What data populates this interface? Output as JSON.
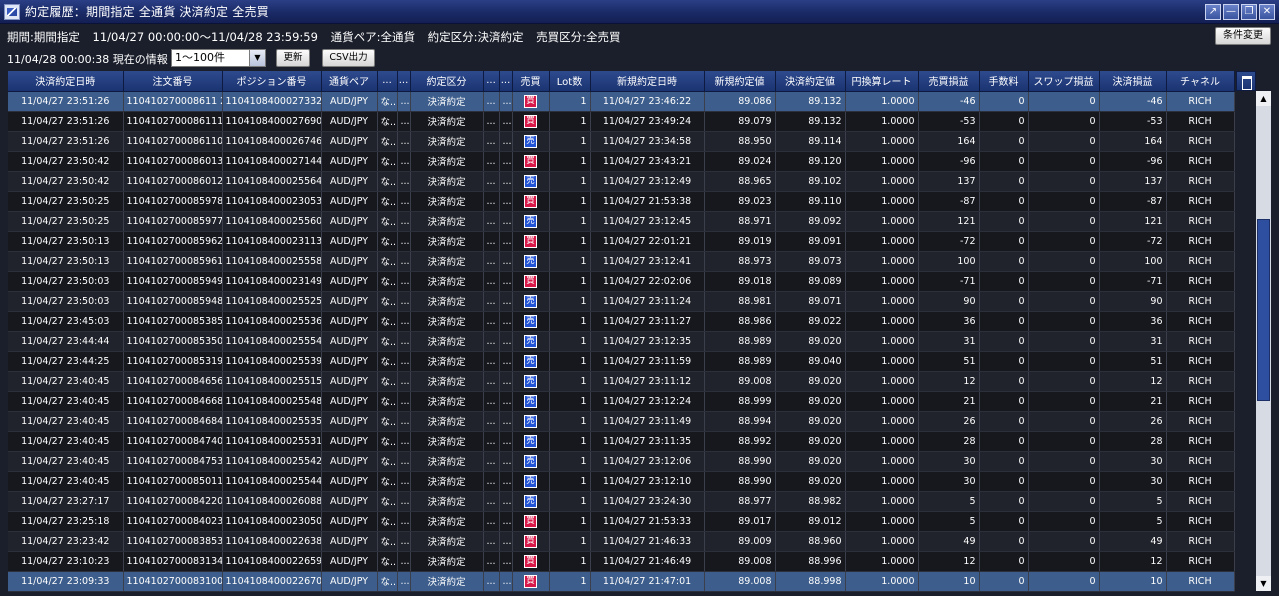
{
  "window": {
    "title": "約定履歴：期間指定 全通貨 決済約定 全売買",
    "controls": [
      "↗",
      "—",
      "❐",
      "✕"
    ]
  },
  "filters": {
    "period_label": "期間:期間指定",
    "period_range": "11/04/27 00:00:00〜11/04/28 23:59:59",
    "pair": "通貨ペア:全通貨",
    "trade_type": "約定区分:決済約定",
    "side": "売買区分:全売買",
    "change_button": "条件変更"
  },
  "toolbar": {
    "info": "11/04/28 00:00:38 現在の情報",
    "page_select": "1〜100件",
    "update_button": "更新",
    "csv_button": "CSV出力"
  },
  "grid": {
    "columns": [
      "決済約定日時",
      "注文番号",
      "ポジション番号",
      "通貨ペア",
      "...",
      "...",
      "約定区分",
      "...",
      "...",
      "売買",
      "Lot数",
      "新規約定日時",
      "新規約定値",
      "決済約定値",
      "円換算レート",
      "売買損益",
      "手数料",
      "スワップ損益",
      "決済損益",
      "チャネル"
    ],
    "rows": [
      [
        "11/04/27 23:51:26",
        "110410270008611 2",
        "1104108400027332",
        "AUD/JPY",
        "な...",
        "...",
        "決済約定",
        "...",
        "...",
        "買",
        "1",
        "11/04/27 23:46:22",
        "89.086",
        "89.132",
        "1.0000",
        "-46",
        "0",
        "0",
        "-46",
        "RICH"
      ],
      [
        "11/04/27 23:51:26",
        "1104102700086111",
        "1104108400027690",
        "AUD/JPY",
        "な...",
        "...",
        "決済約定",
        "...",
        "...",
        "買",
        "1",
        "11/04/27 23:49:24",
        "89.079",
        "89.132",
        "1.0000",
        "-53",
        "0",
        "0",
        "-53",
        "RICH"
      ],
      [
        "11/04/27 23:51:26",
        "1104102700086110",
        "1104108400026746",
        "AUD/JPY",
        "な...",
        "...",
        "決済約定",
        "...",
        "...",
        "売",
        "1",
        "11/04/27 23:34:58",
        "88.950",
        "89.114",
        "1.0000",
        "164",
        "0",
        "0",
        "164",
        "RICH"
      ],
      [
        "11/04/27 23:50:42",
        "1104102700086013",
        "1104108400027144",
        "AUD/JPY",
        "な...",
        "...",
        "決済約定",
        "...",
        "...",
        "買",
        "1",
        "11/04/27 23:43:21",
        "89.024",
        "89.120",
        "1.0000",
        "-96",
        "0",
        "0",
        "-96",
        "RICH"
      ],
      [
        "11/04/27 23:50:42",
        "1104102700086012",
        "1104108400025564",
        "AUD/JPY",
        "な...",
        "...",
        "決済約定",
        "...",
        "...",
        "売",
        "1",
        "11/04/27 23:12:49",
        "88.965",
        "89.102",
        "1.0000",
        "137",
        "0",
        "0",
        "137",
        "RICH"
      ],
      [
        "11/04/27 23:50:25",
        "1104102700085978",
        "1104108400023053",
        "AUD/JPY",
        "な...",
        "...",
        "決済約定",
        "...",
        "...",
        "買",
        "1",
        "11/04/27 21:53:38",
        "89.023",
        "89.110",
        "1.0000",
        "-87",
        "0",
        "0",
        "-87",
        "RICH"
      ],
      [
        "11/04/27 23:50:25",
        "1104102700085977",
        "1104108400025560",
        "AUD/JPY",
        "な...",
        "...",
        "決済約定",
        "...",
        "...",
        "売",
        "1",
        "11/04/27 23:12:45",
        "88.971",
        "89.092",
        "1.0000",
        "121",
        "0",
        "0",
        "121",
        "RICH"
      ],
      [
        "11/04/27 23:50:13",
        "1104102700085962",
        "1104108400023113",
        "AUD/JPY",
        "な...",
        "...",
        "決済約定",
        "...",
        "...",
        "買",
        "1",
        "11/04/27 22:01:21",
        "89.019",
        "89.091",
        "1.0000",
        "-72",
        "0",
        "0",
        "-72",
        "RICH"
      ],
      [
        "11/04/27 23:50:13",
        "1104102700085961",
        "1104108400025558",
        "AUD/JPY",
        "な...",
        "...",
        "決済約定",
        "...",
        "...",
        "売",
        "1",
        "11/04/27 23:12:41",
        "88.973",
        "89.073",
        "1.0000",
        "100",
        "0",
        "0",
        "100",
        "RICH"
      ],
      [
        "11/04/27 23:50:03",
        "1104102700085949",
        "1104108400023149",
        "AUD/JPY",
        "な...",
        "...",
        "決済約定",
        "...",
        "...",
        "買",
        "1",
        "11/04/27 22:02:06",
        "89.018",
        "89.089",
        "1.0000",
        "-71",
        "0",
        "0",
        "-71",
        "RICH"
      ],
      [
        "11/04/27 23:50:03",
        "1104102700085948",
        "1104108400025525",
        "AUD/JPY",
        "な...",
        "...",
        "決済約定",
        "...",
        "...",
        "売",
        "1",
        "11/04/27 23:11:24",
        "88.981",
        "89.071",
        "1.0000",
        "90",
        "0",
        "0",
        "90",
        "RICH"
      ],
      [
        "11/04/27 23:45:03",
        "1104102700085385",
        "1104108400025536",
        "AUD/JPY",
        "な...",
        "...",
        "決済約定",
        "...",
        "...",
        "売",
        "1",
        "11/04/27 23:11:27",
        "88.986",
        "89.022",
        "1.0000",
        "36",
        "0",
        "0",
        "36",
        "RICH"
      ],
      [
        "11/04/27 23:44:44",
        "1104102700085350",
        "1104108400025554",
        "AUD/JPY",
        "な...",
        "...",
        "決済約定",
        "...",
        "...",
        "売",
        "1",
        "11/04/27 23:12:35",
        "88.989",
        "89.020",
        "1.0000",
        "31",
        "0",
        "0",
        "31",
        "RICH"
      ],
      [
        "11/04/27 23:44:25",
        "1104102700085319",
        "1104108400025539",
        "AUD/JPY",
        "な...",
        "...",
        "決済約定",
        "...",
        "...",
        "売",
        "1",
        "11/04/27 23:11:59",
        "88.989",
        "89.040",
        "1.0000",
        "51",
        "0",
        "0",
        "51",
        "RICH"
      ],
      [
        "11/04/27 23:40:45",
        "1104102700084656",
        "1104108400025515",
        "AUD/JPY",
        "な...",
        "...",
        "決済約定",
        "... 8...",
        "...",
        "売",
        "1",
        "11/04/27 23:11:12",
        "89.008",
        "89.020",
        "1.0000",
        "12",
        "0",
        "0",
        "12",
        "RICH"
      ],
      [
        "11/04/27 23:40:45",
        "1104102700084668",
        "1104108400025548",
        "AUD/JPY",
        "な...",
        "...",
        "決済約定",
        "... 8...",
        "...",
        "売",
        "1",
        "11/04/27 23:12:24",
        "88.999",
        "89.020",
        "1.0000",
        "21",
        "0",
        "0",
        "21",
        "RICH"
      ],
      [
        "11/04/27 23:40:45",
        "1104102700084684",
        "1104108400025535",
        "AUD/JPY",
        "な...",
        "...",
        "決済約定",
        "... 8...",
        "...",
        "売",
        "1",
        "11/04/27 23:11:49",
        "88.994",
        "89.020",
        "1.0000",
        "26",
        "0",
        "0",
        "26",
        "RICH"
      ],
      [
        "11/04/27 23:40:45",
        "1104102700084740",
        "1104108400025531",
        "AUD/JPY",
        "な...",
        "...",
        "決済約定",
        "... 8...",
        "...",
        "売",
        "1",
        "11/04/27 23:11:35",
        "88.992",
        "89.020",
        "1.0000",
        "28",
        "0",
        "0",
        "28",
        "RICH"
      ],
      [
        "11/04/27 23:40:45",
        "1104102700084753",
        "1104108400025542",
        "AUD/JPY",
        "な...",
        "...",
        "決済約定",
        "... 8...",
        "...",
        "売",
        "1",
        "11/04/27 23:12:06",
        "88.990",
        "89.020",
        "1.0000",
        "30",
        "0",
        "0",
        "30",
        "RICH"
      ],
      [
        "11/04/27 23:40:45",
        "1104102700085011",
        "1104108400025544",
        "AUD/JPY",
        "な...",
        "...",
        "決済約定",
        "... 8...",
        "...",
        "売",
        "1",
        "11/04/27 23:12:10",
        "88.990",
        "89.020",
        "1.0000",
        "30",
        "0",
        "0",
        "30",
        "RICH"
      ],
      [
        "11/04/27 23:27:17",
        "1104102700084220",
        "1104108400026088",
        "AUD/JPY",
        "な...",
        "...",
        "決済約定",
        "... 8...",
        "...",
        "売",
        "1",
        "11/04/27 23:24:30",
        "88.977",
        "88.982",
        "1.0000",
        "5",
        "0",
        "0",
        "5",
        "RICH"
      ],
      [
        "11/04/27 23:25:18",
        "1104102700084023",
        "1104108400023050",
        "AUD/JPY",
        "な...",
        "...",
        "決済約定",
        "... 8...",
        "...",
        "買",
        "1",
        "11/04/27 21:53:33",
        "89.017",
        "89.012",
        "1.0000",
        "5",
        "0",
        "0",
        "5",
        "RICH"
      ],
      [
        "11/04/27 23:23:42",
        "1104102700083853",
        "1104108400022638",
        "AUD/JPY",
        "な...",
        "...",
        "決済約定",
        "... 8...",
        "...",
        "買",
        "1",
        "11/04/27 21:46:33",
        "89.009",
        "88.960",
        "1.0000",
        "49",
        "0",
        "0",
        "49",
        "RICH"
      ],
      [
        "11/04/27 23:10:23",
        "1104102700083134",
        "1104108400022659",
        "AUD/JPY",
        "な...",
        "...",
        "決済約定",
        "... 8...",
        "...",
        "買",
        "1",
        "11/04/27 21:46:49",
        "89.008",
        "88.996",
        "1.0000",
        "12",
        "0",
        "0",
        "12",
        "RICH"
      ],
      [
        "11/04/27 23:09:33",
        "1104102700083100",
        "1104108400022670",
        "AUD/JPY",
        "な...",
        "...",
        "決済約定",
        "... 8...",
        "...",
        "買",
        "1",
        "11/04/27 21:47:01",
        "89.008",
        "88.998",
        "1.0000",
        "10",
        "0",
        "0",
        "10",
        "RICH"
      ]
    ]
  },
  "colors": {
    "pair": "#f0b020",
    "negative": "#ff4080",
    "sell_badge": "#2454d6",
    "buy_badge": "#d81848",
    "header": "#1b3371",
    "selected_row": "#3d5e8c"
  },
  "icons": {
    "app": "app-logo-icon",
    "column_settings": "column-settings-icon"
  }
}
